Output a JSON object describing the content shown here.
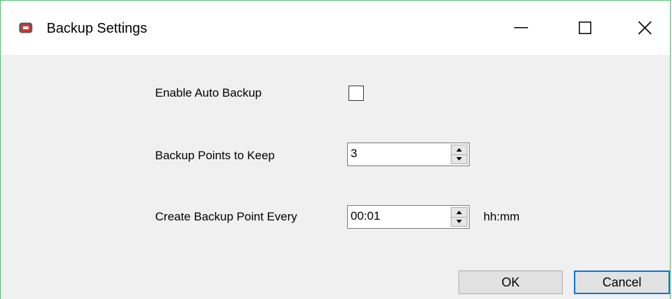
{
  "window": {
    "title": "Backup Settings",
    "icon": "app-icon",
    "controls": {
      "minimize": "minimize-icon",
      "maximize": "maximize-icon",
      "close": "close-icon"
    }
  },
  "form": {
    "enable_auto_backup": {
      "label": "Enable Auto Backup",
      "checked": false
    },
    "backup_points": {
      "label": "Backup Points to Keep",
      "value": "3"
    },
    "backup_interval": {
      "label": "Create Backup Point Every",
      "value": "00:01",
      "unit": "hh:mm"
    }
  },
  "buttons": {
    "ok": "OK",
    "cancel": "Cancel"
  },
  "colors": {
    "window_border": "#5fb878",
    "default_button_border": "#0078d7",
    "background": "#f0f0f0"
  }
}
